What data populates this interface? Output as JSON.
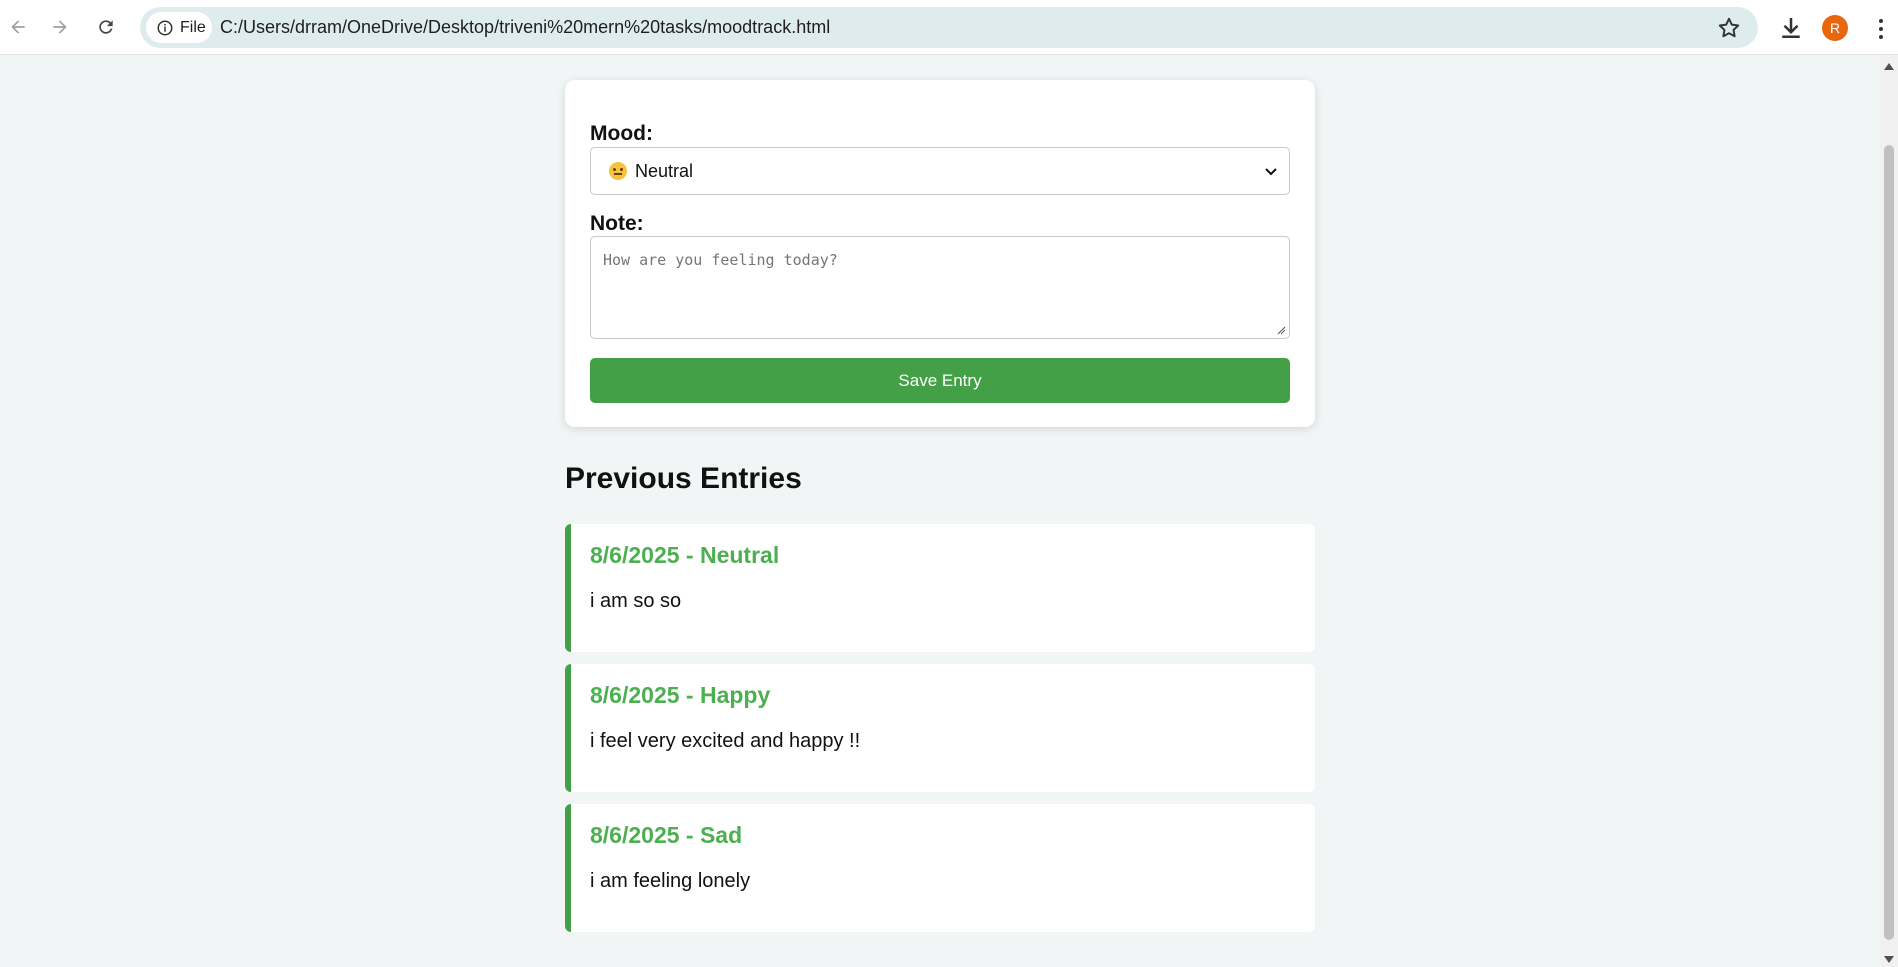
{
  "browser": {
    "chip_label": "File",
    "url": "C:/Users/drram/OneDrive/Desktop/triveni%20mern%20tasks/moodtrack.html",
    "avatar_letter": "R",
    "icons": [
      "back-arrow-icon",
      "forward-arrow-icon",
      "reload-icon",
      "info-icon",
      "star-icon",
      "download-icon",
      "more-vert-icon"
    ]
  },
  "form": {
    "mood_label": "Mood:",
    "mood_selected": "Neutral",
    "note_label": "Note:",
    "note_placeholder": "How are you feeling today?",
    "save_label": "Save Entry"
  },
  "entries_section": {
    "title": "Previous Entries",
    "items": [
      {
        "title": "8/6/2025 - Neutral",
        "note": "i am so so"
      },
      {
        "title": "8/6/2025 - Happy",
        "note": "i feel very excited and happy !!"
      },
      {
        "title": "8/6/2025 - Sad",
        "note": "i am feeling lonely"
      }
    ]
  },
  "colors": {
    "accent": "#44a047",
    "entry_title": "#4caf50",
    "page_bg": "#f1f5f5",
    "omnibox_bg": "#dfecee",
    "avatar_bg": "#e8660c"
  }
}
